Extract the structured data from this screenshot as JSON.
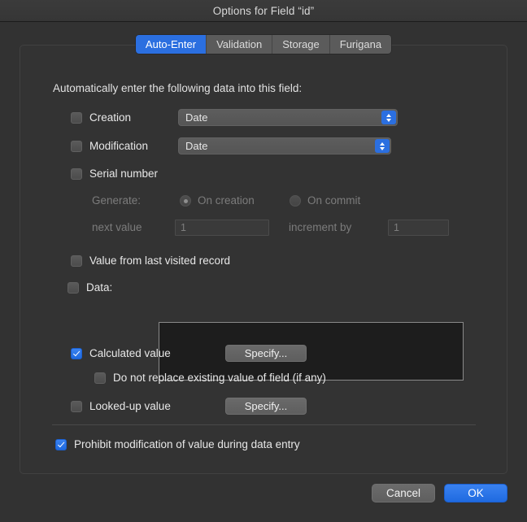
{
  "window": {
    "title": "Options for Field “id”"
  },
  "tabs": [
    {
      "label": "Auto-Enter",
      "selected": true
    },
    {
      "label": "Validation",
      "selected": false
    },
    {
      "label": "Storage",
      "selected": false
    },
    {
      "label": "Furigana",
      "selected": false
    }
  ],
  "panel": {
    "intro": "Automatically enter the following data into this field:",
    "creation": {
      "label": "Creation",
      "checked": false,
      "popup_value": "Date"
    },
    "modification": {
      "label": "Modification",
      "checked": false,
      "popup_value": "Date"
    },
    "serial_number": {
      "label": "Serial number",
      "checked": false,
      "generate_label": "Generate:",
      "on_creation_label": "On creation",
      "on_creation_selected": true,
      "on_commit_label": "On commit",
      "on_commit_selected": false,
      "next_value_label": "next value",
      "next_value": "1",
      "increment_by_label": "increment by",
      "increment_by": "1"
    },
    "value_from_last_visited": {
      "label": "Value from last visited record",
      "checked": false
    },
    "data": {
      "label": "Data:",
      "checked": false,
      "value": ""
    },
    "calculated_value": {
      "label": "Calculated value",
      "checked": true,
      "specify_label": "Specify..."
    },
    "do_not_replace": {
      "label": "Do not replace existing value of field (if any)",
      "checked": false
    },
    "looked_up_value": {
      "label": "Looked-up value",
      "checked": false,
      "specify_label": "Specify..."
    },
    "prohibit_modification": {
      "label": "Prohibit modification of value during data entry",
      "checked": true
    }
  },
  "footer": {
    "cancel_label": "Cancel",
    "ok_label": "OK"
  },
  "colors": {
    "accent": "#2b6fe0",
    "window_bg": "#323232",
    "panel_bg": "#333333",
    "text": "#e8e8e8",
    "disabled_text": "#7c7c7c"
  }
}
